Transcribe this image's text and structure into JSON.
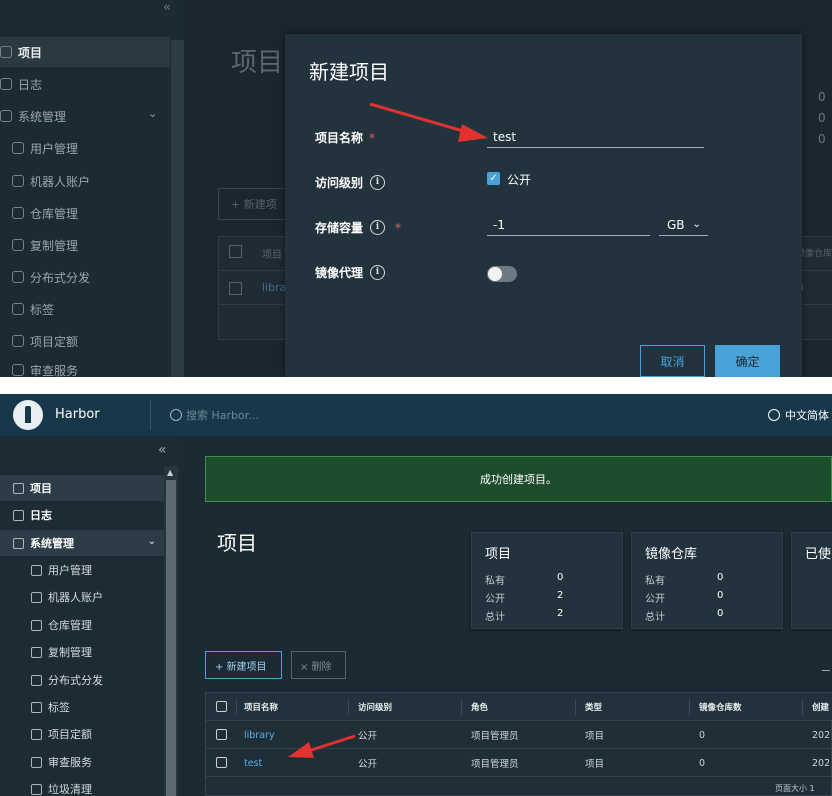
{
  "top_panel": {
    "sidebar": {
      "collapse_icon": "«",
      "items": [
        {
          "label": "项目",
          "icon": "projects-icon",
          "active": true
        },
        {
          "label": "日志",
          "icon": "logs-icon"
        },
        {
          "label": "系统管理",
          "icon": "admin-icon"
        },
        {
          "label": "用户管理",
          "icon": "users-icon"
        },
        {
          "label": "机器人账户",
          "icon": "robot-icon"
        },
        {
          "label": "仓库管理",
          "icon": "registry-icon"
        },
        {
          "label": "复制管理",
          "icon": "replication-icon"
        },
        {
          "label": "分布式分发",
          "icon": "distribution-icon"
        },
        {
          "label": "标签",
          "icon": "label-icon"
        },
        {
          "label": "项目定额",
          "icon": "quota-icon"
        },
        {
          "label": "审查服务",
          "icon": "scan-icon"
        }
      ]
    },
    "background": {
      "page_title": "项目",
      "new_button": "+ 新建项",
      "table_header_name": "项目",
      "table_header_repo": "镜像仓库",
      "row_name": "libra",
      "numbers": [
        "0",
        "0",
        "0",
        "0"
      ]
    },
    "modal": {
      "title": "新建项目",
      "project_name_label": "项目名称",
      "project_name_value": "test",
      "access_label": "访问级别",
      "public_label": "公开",
      "public_checked": true,
      "storage_label": "存储容量",
      "storage_value": "-1",
      "storage_unit": "GB",
      "proxy_label": "镜像代理",
      "proxy_enabled": false,
      "cancel_label": "取消",
      "ok_label": "确定",
      "required_mark": "*",
      "info_mark": "i"
    }
  },
  "bottom_panel": {
    "header": {
      "brand": "Harbor",
      "search_placeholder": "搜索 Harbor...",
      "language": "中文简体"
    },
    "sidebar": {
      "collapse_icon": "«",
      "items": [
        {
          "label": "项目",
          "icon": "projects-icon"
        },
        {
          "label": "日志",
          "icon": "logs-icon"
        },
        {
          "label": "系统管理",
          "icon": "admin-icon"
        },
        {
          "label": "用户管理",
          "icon": "users-icon"
        },
        {
          "label": "机器人账户",
          "icon": "robot-icon"
        },
        {
          "label": "仓库管理",
          "icon": "registry-icon"
        },
        {
          "label": "复制管理",
          "icon": "replication-icon"
        },
        {
          "label": "分布式分发",
          "icon": "distribution-icon"
        },
        {
          "label": "标签",
          "icon": "label-icon"
        },
        {
          "label": "项目定额",
          "icon": "quota-icon"
        },
        {
          "label": "审查服务",
          "icon": "scan-icon"
        },
        {
          "label": "垃圾清理",
          "icon": "gc-icon"
        }
      ]
    },
    "alert": "成功创建项目。",
    "page_title": "项目",
    "cards": [
      {
        "title": "项目",
        "rows": [
          {
            "label": "私有",
            "value": "0"
          },
          {
            "label": "公开",
            "value": "2"
          },
          {
            "label": "总计",
            "value": "2"
          }
        ]
      },
      {
        "title": "镜像仓库",
        "rows": [
          {
            "label": "私有",
            "value": "0"
          },
          {
            "label": "公开",
            "value": "0"
          },
          {
            "label": "总计",
            "value": "0"
          }
        ]
      },
      {
        "title": "已使",
        "rows": []
      }
    ],
    "buttons": {
      "new_project": "+ 新建项目",
      "delete": "× 删除"
    },
    "table": {
      "headers": [
        "项目名称",
        "访问级别",
        "角色",
        "类型",
        "镜像仓库数",
        "创建"
      ],
      "rows": [
        [
          "library",
          "公开",
          "项目管理员",
          "项目",
          "0",
          "202"
        ],
        [
          "test",
          "公开",
          "项目管理员",
          "项目",
          "0",
          "202"
        ]
      ]
    },
    "footer": "页面大小  1"
  },
  "colors": {
    "accent": "#49a3d9",
    "arrow": "#e0322f",
    "success_bg": "#1e4d2b",
    "header_bg": "#17384a"
  }
}
